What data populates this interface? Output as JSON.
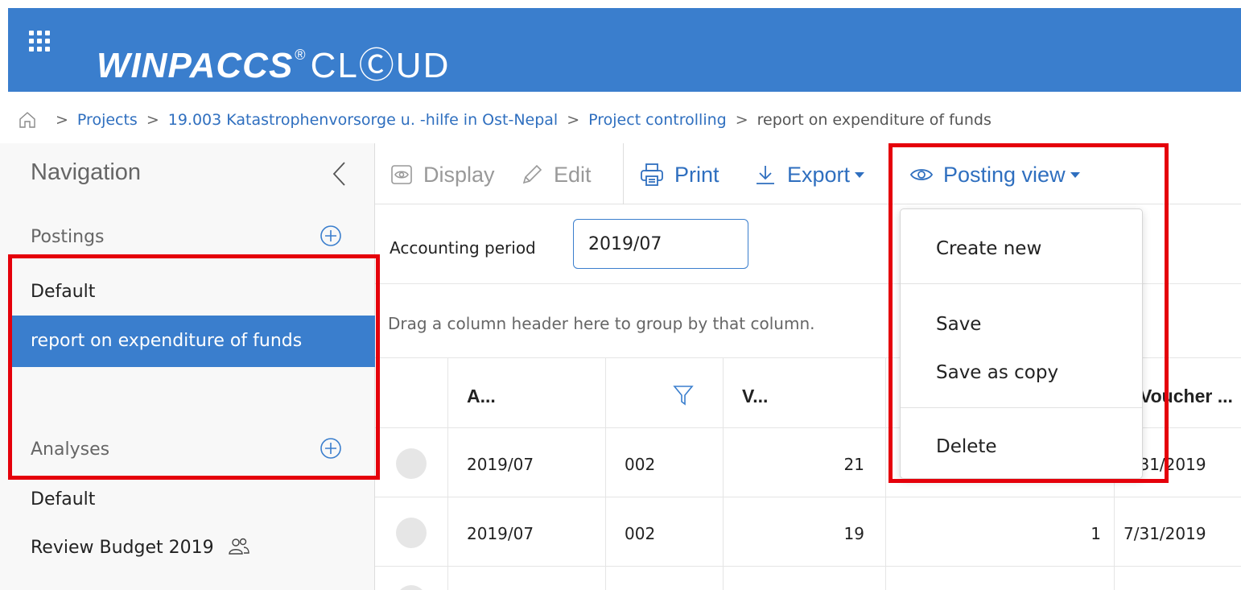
{
  "header": {
    "brand_bold": "WINPACCS",
    "brand_reg": "®",
    "brand_cloud": "CLⒸUD"
  },
  "breadcrumb": {
    "items": [
      "Projects",
      "19.003 Katastrophenvorsorge u. -hilfe in Ost-Nepal",
      "Project controlling"
    ],
    "current": "report on expenditure of funds",
    "separator": ">"
  },
  "navigation": {
    "title": "Navigation",
    "postings_label": "Postings",
    "postings_items": [
      "Default",
      "report on expenditure of funds"
    ],
    "analyses_label": "Analyses",
    "analyses_items": [
      "Default",
      "Review Budget 2019"
    ]
  },
  "toolbar": {
    "display_label": "Display",
    "edit_label": "Edit",
    "print_label": "Print",
    "export_label": "Export",
    "posting_view_label": "Posting view"
  },
  "filter": {
    "accounting_period_label": "Accounting period",
    "accounting_period_value": "2019/07"
  },
  "grid": {
    "group_hint": "Drag a column header here to group by that column.",
    "headers": [
      "A...",
      "V...",
      "Voucher ..."
    ],
    "rows": [
      {
        "period": "2019/07",
        "code": "002",
        "number": "21",
        "extra": "",
        "date": "7/31/2019"
      },
      {
        "period": "2019/07",
        "code": "002",
        "number": "19",
        "extra": "1",
        "date": "7/31/2019"
      }
    ]
  },
  "posting_view_menu": {
    "items": [
      "Create new",
      "Save",
      "Save as copy",
      "Delete"
    ]
  },
  "colors": {
    "brand_blue": "#3a7ecd",
    "link_blue": "#2f6fbf",
    "highlight_red": "#e5000b"
  }
}
